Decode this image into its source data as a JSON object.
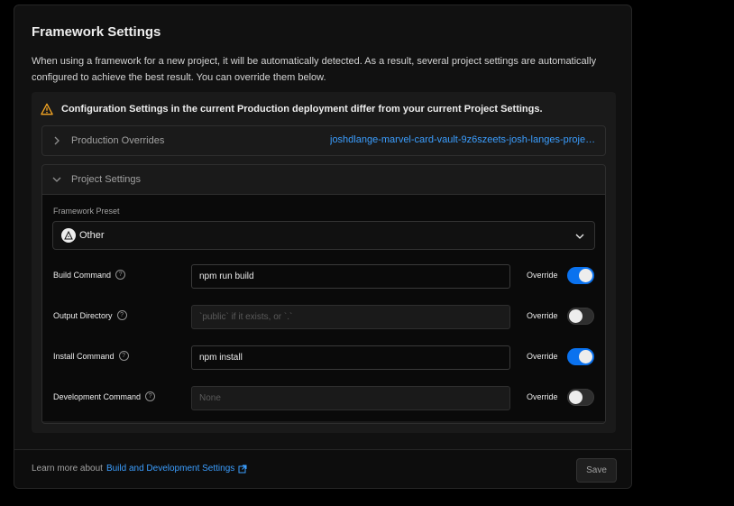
{
  "section": {
    "title": "Framework Settings",
    "description": "When using a framework for a new project, it will be automatically detected. As a result, several project settings are automatically configured to achieve the best result. You can override them below."
  },
  "warning": {
    "text": "Configuration Settings in the current Production deployment differ from your current Project Settings.",
    "color": "#f5a623"
  },
  "production_overrides": {
    "label": "Production Overrides",
    "link": "joshdlange-marvel-card-vault-9z6szeets-josh-langes-projects.vercel.app"
  },
  "project_settings": {
    "label": "Project Settings",
    "framework_preset": {
      "label": "Framework Preset",
      "value": "Other"
    },
    "settings": [
      {
        "label": "Build Command",
        "value": "npm run build",
        "placeholder": "",
        "override_label": "Override",
        "override": true
      },
      {
        "label": "Output Directory",
        "value": "",
        "placeholder": "`public` if it exists, or `.`",
        "override_label": "Override",
        "override": false
      },
      {
        "label": "Install Command",
        "value": "npm install",
        "placeholder": "",
        "override_label": "Override",
        "override": true
      },
      {
        "label": "Development Command",
        "value": "",
        "placeholder": "None",
        "override_label": "Override",
        "override": false
      }
    ]
  },
  "footer": {
    "learn_prefix": "Learn more about",
    "learn_link": "Build and Development Settings",
    "save_label": "Save"
  },
  "colors": {
    "accent": "#0a72ef",
    "link": "#3b9eff"
  }
}
